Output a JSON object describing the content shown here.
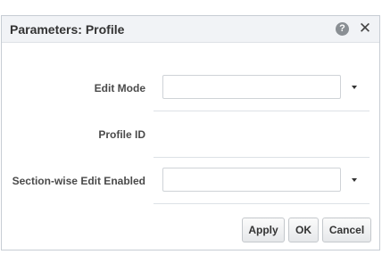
{
  "dialog": {
    "title": "Parameters: Profile",
    "help_icon": "help-icon",
    "close_icon": "close-icon",
    "help_glyph": "?",
    "close_glyph": "✕"
  },
  "form": {
    "edit_mode": {
      "label": "Edit Mode",
      "value": "",
      "icon": "chevron-down-icon"
    },
    "profile_id": {
      "label": "Profile ID",
      "value": ""
    },
    "section_edit": {
      "label": "Section-wise Edit Enabled",
      "value": "",
      "icon": "chevron-down-icon"
    }
  },
  "buttons": {
    "apply": "Apply",
    "ok": "OK",
    "cancel": "Cancel"
  }
}
